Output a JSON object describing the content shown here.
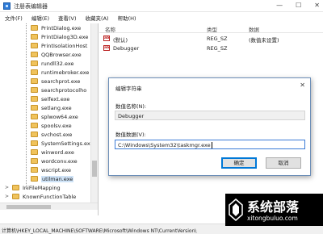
{
  "window": {
    "title": "注册表编辑器",
    "minimize": "—",
    "maximize": "☐",
    "close": "✕"
  },
  "menu": [
    "文件(F)",
    "编辑(E)",
    "查看(V)",
    "收藏夹(A)",
    "帮助(H)"
  ],
  "tree": {
    "items": [
      "PrintDialog.exe",
      "PrintDialog3D.exe",
      "PrintIsolationHost",
      "QQBrowser.exe",
      "rundll32.exe",
      "runtimebroker.exe",
      "searchprot.exe",
      "searchprotocolho",
      "selfext.exe",
      "setlang.exe",
      "splwow64.exe",
      "spoolsv.exe",
      "svchost.exe",
      "SystemSettings.ex",
      "winword.exe",
      "wordconv.exe",
      "wscript.exe",
      "utilman.exe"
    ],
    "selected_index": 17,
    "collapsed": [
      {
        "expander": ">",
        "label": "IniFileMapping"
      },
      {
        "expander": ">",
        "label": "KnownFunctionTable"
      }
    ]
  },
  "list": {
    "columns": {
      "name": "名称",
      "type": "类型",
      "data": "数据"
    },
    "rows": [
      {
        "icon": "ab",
        "name": "(默认)",
        "type": "REG_SZ",
        "data": "(数值未设置)"
      },
      {
        "icon": "ab",
        "name": "Debugger",
        "type": "REG_SZ",
        "data": ""
      }
    ]
  },
  "dialog": {
    "title": "编辑字符串",
    "close": "✕",
    "name_label": "数值名称(N):",
    "name_value": "Debugger",
    "data_label": "数值数据(V):",
    "data_value": "C:\\Windows\\System32\\taskmgr.exe",
    "ok_label": "确定",
    "cancel_label": "取消"
  },
  "status": {
    "path": "计算机\\HKEY_LOCAL_MACHINE\\SOFTWARE\\Microsoft\\Windows NT\\CurrentVersion\\"
  },
  "watermark": {
    "title": "系统部落",
    "url": "xitongbuluo.com"
  }
}
